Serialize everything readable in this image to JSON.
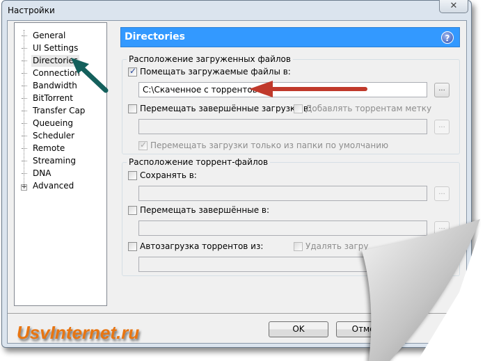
{
  "window": {
    "title": "Настройки",
    "close_icon": "close-icon"
  },
  "sidebar": {
    "items": [
      {
        "label": "General"
      },
      {
        "label": "UI Settings"
      },
      {
        "label": "Directories",
        "selected": true
      },
      {
        "label": "Connection"
      },
      {
        "label": "Bandwidth"
      },
      {
        "label": "BitTorrent"
      },
      {
        "label": "Transfer Cap"
      },
      {
        "label": "Queueing"
      },
      {
        "label": "Scheduler"
      },
      {
        "label": "Remote"
      },
      {
        "label": "Streaming"
      },
      {
        "label": "DNA"
      },
      {
        "label": "Advanced",
        "expandable": true
      }
    ]
  },
  "header": {
    "title": "Directories",
    "help": "?"
  },
  "group1": {
    "legend": "Расположение загруженных файлов",
    "put_downloads": {
      "label": "Помещать загружаемые файлы в:",
      "checked": true,
      "value": "C:\\Скаченное с торрентов"
    },
    "move_completed": {
      "label": "Перемещать завершённые загрузки в:",
      "checked": false,
      "value": ""
    },
    "add_label": {
      "label": "Добавлять торрентам метку",
      "checked": false
    },
    "only_default": {
      "label": "Перемещать загрузки только из папки по умолчанию",
      "checked": true
    }
  },
  "group2": {
    "legend": "Расположение торрент-файлов",
    "save_to": {
      "label": "Сохранять в:",
      "checked": false
    },
    "move_completed": {
      "label": "Перемещать завершённые в:",
      "checked": false
    },
    "autoload": {
      "label": "Автозагрузка торрентов из:",
      "checked": false
    },
    "delete_loaded": {
      "label": "Удалять загру",
      "checked": false
    }
  },
  "browse_label": "...",
  "buttons": {
    "ok": "OK",
    "cancel": "Отмен"
  },
  "watermark": "UsvInternet.ru",
  "colors": {
    "header": "#3399ff",
    "watermark": "#e87511",
    "arrow_green": "#14605c",
    "arrow_red": "#c0392b"
  }
}
